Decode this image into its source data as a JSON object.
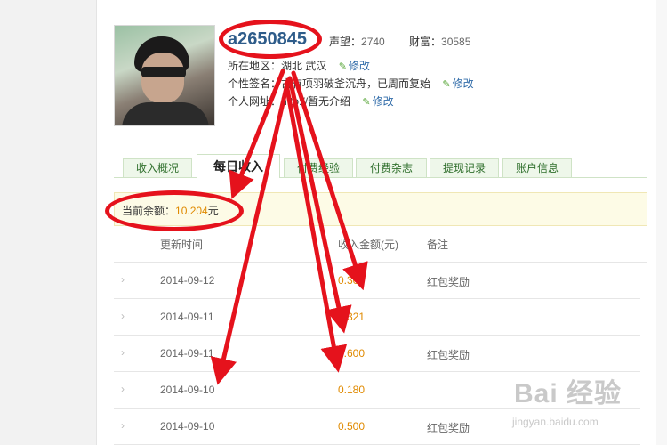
{
  "profile": {
    "username": "a2650845",
    "reputation_label": "声望：",
    "reputation_value": "2740",
    "wealth_label": "财富：",
    "wealth_value": "30585",
    "location_label": "所在地区：",
    "location_value": "湖北 武汉",
    "signature_label": "个性签名：",
    "signature_value": "古有项羽破釜沉舟，已周而复始",
    "website_label": "个人网址：",
    "website_value": "http://暂无介绍",
    "edit_label": "修改"
  },
  "tabs": [
    "收入概况",
    "每日收入",
    "付费经验",
    "付费杂志",
    "提现记录",
    "账户信息"
  ],
  "active_tab": "每日收入",
  "balance": {
    "label": "当前余额：",
    "value": "10.204",
    "unit": "元"
  },
  "table": {
    "headers": [
      "更新时间",
      "收入金额(元)",
      "备注"
    ],
    "rows": [
      {
        "date": "2014-09-12",
        "amount": "0.300",
        "note": "红包奖励"
      },
      {
        "date": "2014-09-11",
        "amount": "0.321",
        "note": ""
      },
      {
        "date": "2014-09-11",
        "amount": "0.600",
        "note": "红包奖励"
      },
      {
        "date": "2014-09-10",
        "amount": "0.180",
        "note": ""
      },
      {
        "date": "2014-09-10",
        "amount": "0.500",
        "note": "红包奖励"
      }
    ]
  },
  "annotation_color": "#e5121c",
  "accent_color": "#e08a00",
  "watermark": {
    "logo": "Bai 经验",
    "url": "jingyan.baidu.com"
  }
}
